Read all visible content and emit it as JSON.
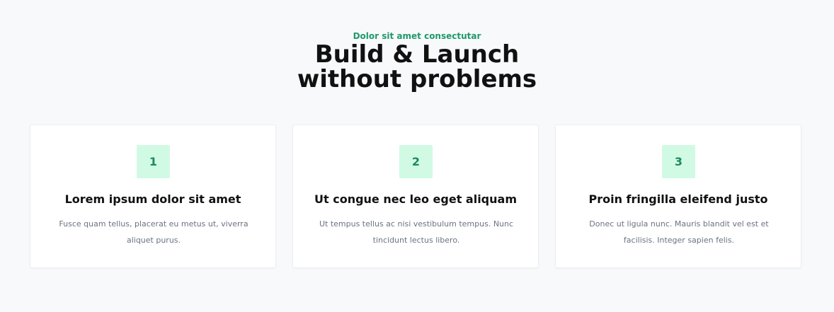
{
  "header": {
    "eyebrow": "Dolor sit amet consectutar",
    "title_line1": "Build & Launch",
    "title_line2": "without problems"
  },
  "features": [
    {
      "number": "1",
      "title": "Lorem ipsum dolor sit amet",
      "text": "Fusce quam tellus, placerat eu metus ut, viverra aliquet purus."
    },
    {
      "number": "2",
      "title": "Ut congue nec leo eget aliquam",
      "text": "Ut tempus tellus ac nisi vestibulum tempus. Nunc tincidunt lectus libero."
    },
    {
      "number": "3",
      "title": "Proin fringilla eleifend justo",
      "text": "Donec ut ligula nunc. Mauris blandit vel est et facilisis. Integer sapien felis."
    }
  ],
  "colors": {
    "accent": "#1f9a6a",
    "badge_bg": "#d1fae5",
    "page_bg": "#f8f9fb"
  }
}
